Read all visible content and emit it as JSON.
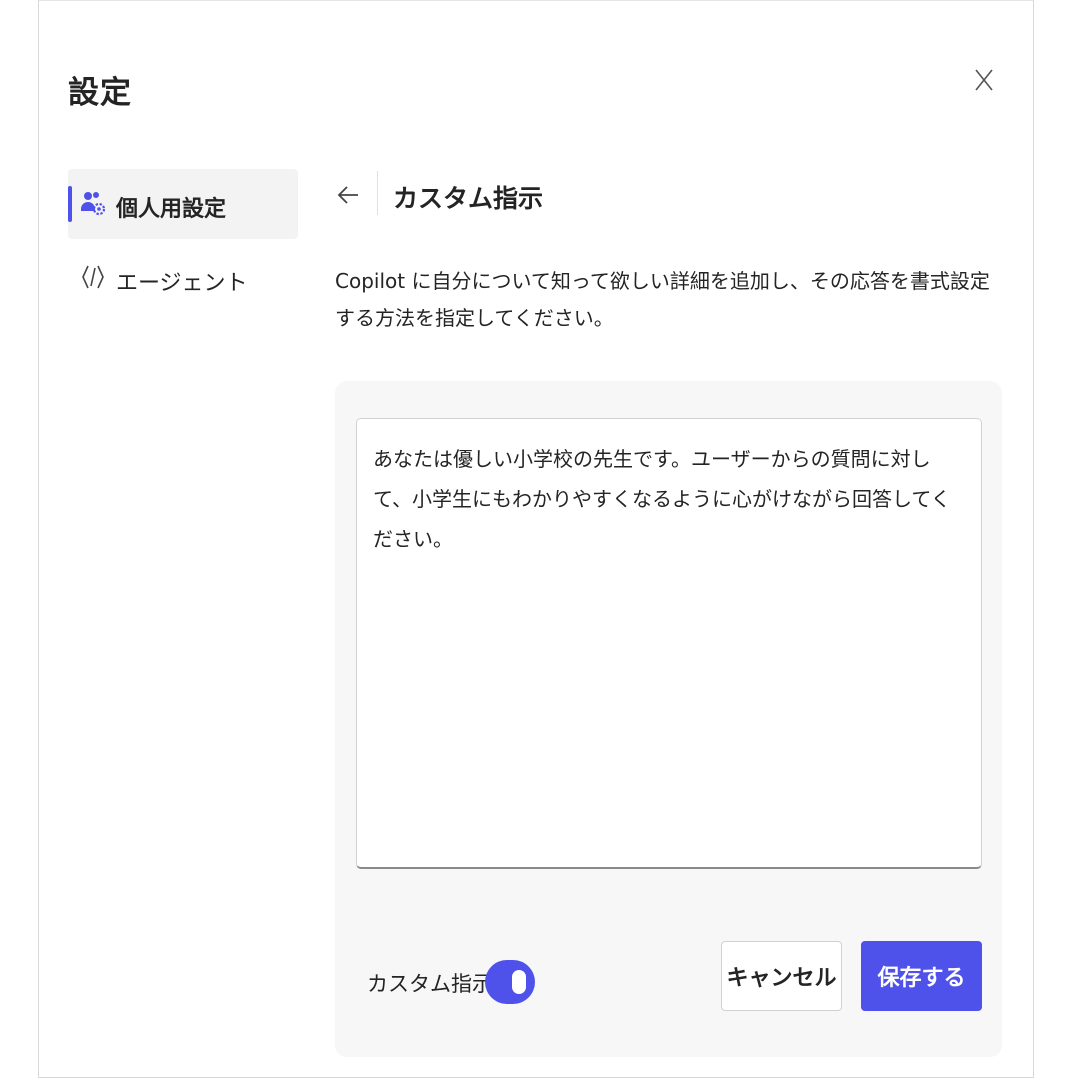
{
  "dialog": {
    "title": "設定",
    "close_icon": "close-icon"
  },
  "sidebar": {
    "items": [
      {
        "label": "個人用設定",
        "icon": "people-settings-icon",
        "active": true
      },
      {
        "label": "エージェント",
        "icon": "code-brackets-icon",
        "active": false
      }
    ]
  },
  "main": {
    "back_icon": "arrow-left-icon",
    "section_title": "カスタム指示",
    "description": "Copilot に自分について知って欲しい詳細を追加し、その応答を書式設定する方法を指定してください。",
    "instructions_value": "あなたは優しい小学校の先生です。ユーザーからの質問に対して、小学生にもわかりやすくなるように心がけながら回答してください。",
    "toggle": {
      "label": "カスタム指示",
      "enabled": true
    },
    "buttons": {
      "cancel": "キャンセル",
      "save": "保存する"
    }
  },
  "colors": {
    "accent": "#4f52ea",
    "text": "#242424",
    "card_background": "#f7f7f7",
    "active_item_background": "#f3f3f3"
  }
}
